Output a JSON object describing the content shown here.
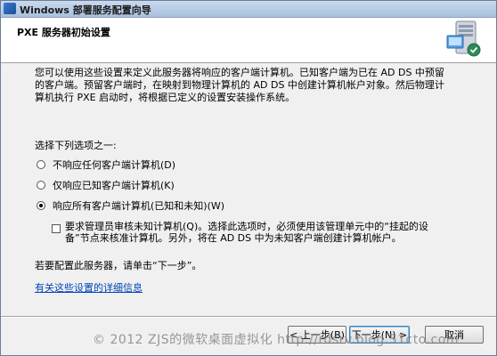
{
  "window": {
    "title": "Windows 部署服务配置向导"
  },
  "header": {
    "title": "PXE 服务器初始设置"
  },
  "content": {
    "intro": "您可以使用这些设置来定义此服务器将响应的客户端计算机。已知客户端为已在 AD DS 中预留的客户端。预留客户端时，在映射到物理计算机的 AD DS 中创建计算机帐户对象。然后物理计算机执行 PXE 启动时，将根据已定义的设置安装操作系统。",
    "choose_label": "选择下列选项之一:",
    "options": [
      {
        "label": "不响应任何客户端计算机(D)",
        "checked": false
      },
      {
        "label": "仅响应已知客户端计算机(K)",
        "checked": false
      },
      {
        "label": "响应所有客户端计算机(已知和未知)(W)",
        "checked": true
      }
    ],
    "approval_checkbox": {
      "label": "要求管理员审核未知计算机(Q)。选择此选项时，必须使用该管理单元中的“挂起的设备”节点来核准计算机。另外，将在 AD DS 中为未知客户端创建计算机帐户。",
      "checked": false
    },
    "instruction": "若要配置此服务器，请单击“下一步”。",
    "details_link": "有关这些设置的详细信息"
  },
  "buttons": {
    "back": "< 上一步(B)",
    "next": "下一步(N) >",
    "cancel": "取消"
  },
  "watermark": "© 2012 ZJS的微软桌面虚拟化 http://rdsrv.blog.51cto.com"
}
